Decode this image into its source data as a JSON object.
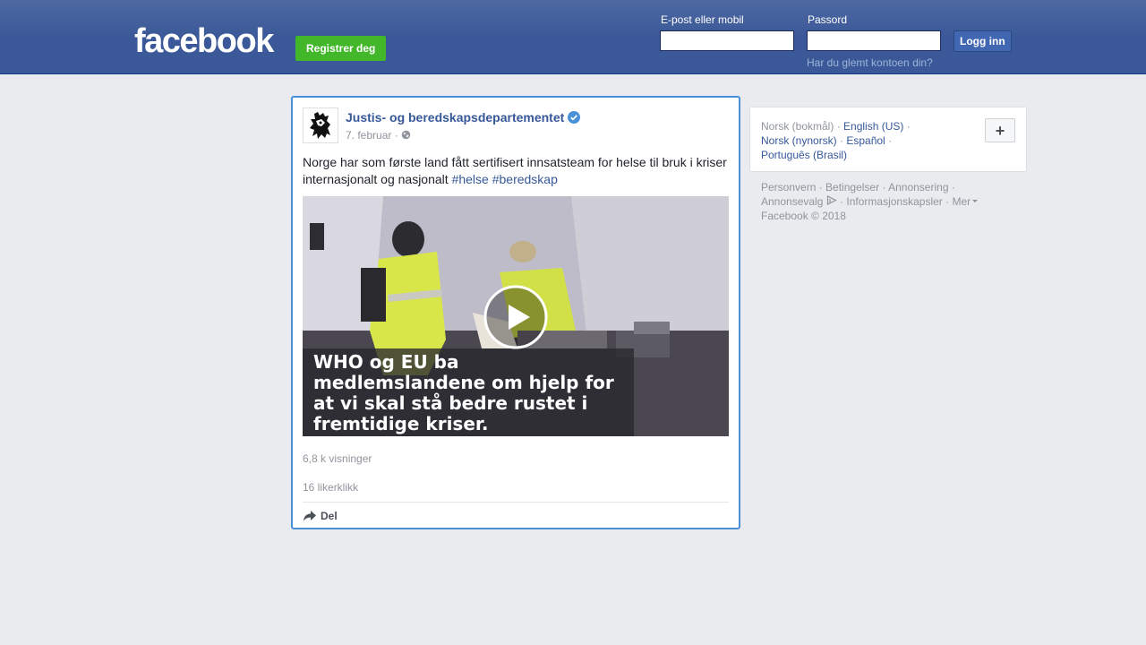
{
  "header": {
    "logo": "facebook",
    "register_label": "Registrer deg",
    "email_label": "E-post eller mobil",
    "email_value": "",
    "password_label": "Passord",
    "password_value": "",
    "login_label": "Logg inn",
    "forgot_label": "Har du glemt kontoen din?"
  },
  "post": {
    "page_name": "Justis- og beredskapsdepartementet",
    "verified": true,
    "date": "7. februar",
    "meta_sep": " · ",
    "text": "Norge har som første land fått sertifisert innsatsteam for helse til bruk i kriser internasjonalt og nasjonalt",
    "hashtags": [
      "#helse",
      "#beredskap"
    ],
    "video_caption": "WHO og EU ba medlemslandene om hjelp for at vi skal stå bedre rustet i fremtidige kriser.",
    "views": "6,8 k visninger",
    "likes": "16 likerklikk",
    "share_label": "Del"
  },
  "sidebar": {
    "languages": [
      {
        "label": "Norsk (bokmål)",
        "current": true
      },
      {
        "label": "English (US)",
        "current": false
      },
      {
        "label": "Norsk (nynorsk)",
        "current": false
      },
      {
        "label": "Español",
        "current": false
      },
      {
        "label": "Português (Brasil)",
        "current": false
      }
    ],
    "plus_label": "+",
    "footer_links": [
      "Personvern",
      "Betingelser",
      "Annonsering",
      "Annonsevalg",
      "Informasjonskapsler",
      "Mer"
    ],
    "copyright": "Facebook © 2018"
  },
  "colors": {
    "brand_blue": "#3b5998",
    "link_blue": "#365899",
    "register_green": "#42b72a",
    "focus_border": "#4a90d9"
  }
}
